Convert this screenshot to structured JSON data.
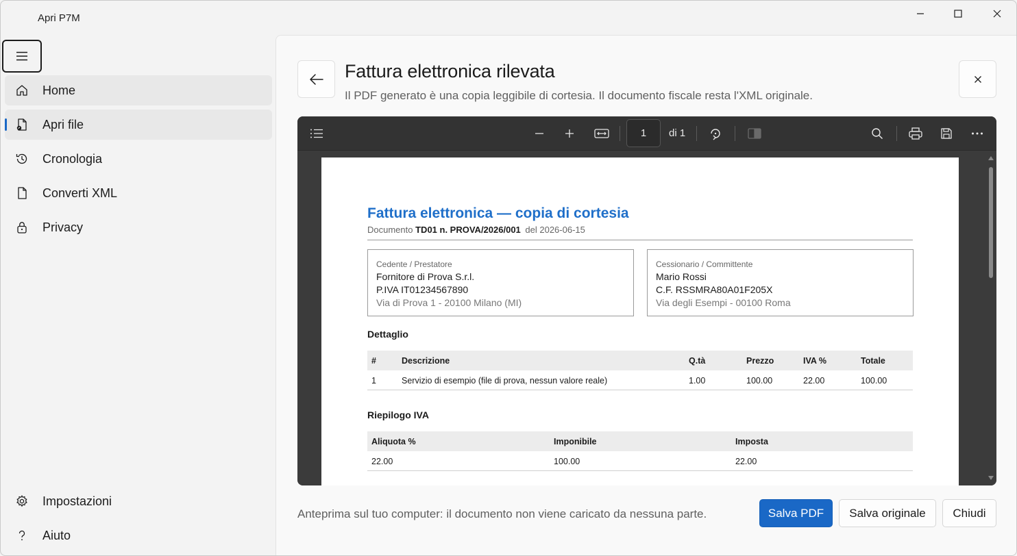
{
  "window": {
    "title": "Apri P7M"
  },
  "sidebar": {
    "items": [
      {
        "label": "Home",
        "icon": "home-icon"
      },
      {
        "label": "Apri file",
        "icon": "open-file-icon"
      },
      {
        "label": "Cronologia",
        "icon": "history-icon"
      },
      {
        "label": "Converti XML",
        "icon": "document-icon"
      },
      {
        "label": "Privacy",
        "icon": "lock-icon"
      }
    ],
    "footer_items": [
      {
        "label": "Impostazioni",
        "icon": "gear-icon"
      },
      {
        "label": "Aiuto",
        "icon": "help-icon"
      }
    ],
    "selected": "Apri file"
  },
  "header": {
    "title": "Fattura elettronica rilevata",
    "subtitle": "Il PDF generato è una copia leggibile di cortesia. Il documento fiscale resta l'XML originale."
  },
  "viewer": {
    "page_number": "1",
    "page_of": "di 1"
  },
  "document": {
    "title": "Fattura elettronica — copia di cortesia",
    "meta_prefix": "Documento",
    "meta_number": "TD01 n. PROVA/2026/001",
    "meta_date": "del 2026-06-15",
    "seller": {
      "label": "Cedente / Prestatore",
      "name": "Fornitore di Prova S.r.l.",
      "id": "P.IVA IT01234567890",
      "address": "Via di Prova 1 - 20100 Milano (MI)"
    },
    "buyer": {
      "label": "Cessionario / Committente",
      "name": "Mario Rossi",
      "id": "C.F. RSSMRA80A01F205X",
      "address": "Via degli Esempi - 00100 Roma"
    },
    "detail_heading": "Dettaglio",
    "detail_columns": [
      "#",
      "Descrizione",
      "Q.tà",
      "Prezzo",
      "IVA %",
      "Totale"
    ],
    "detail_rows": [
      [
        "1",
        "Servizio di esempio (file di prova, nessun valore reale)",
        "1.00",
        "100.00",
        "22.00",
        "100.00"
      ]
    ],
    "summary_heading": "Riepilogo IVA",
    "summary_columns": [
      "Aliquota %",
      "Imponibile",
      "Imposta"
    ],
    "summary_rows": [
      [
        "22.00",
        "100.00",
        "22.00"
      ]
    ]
  },
  "footer": {
    "note": "Anteprima sul tuo computer: il documento non viene caricato da nessuna parte.",
    "save_pdf": "Salva PDF",
    "save_original": "Salva originale",
    "close": "Chiudi"
  },
  "colors": {
    "accent": "#1a68c6",
    "doc_title": "#1f6fc9"
  }
}
